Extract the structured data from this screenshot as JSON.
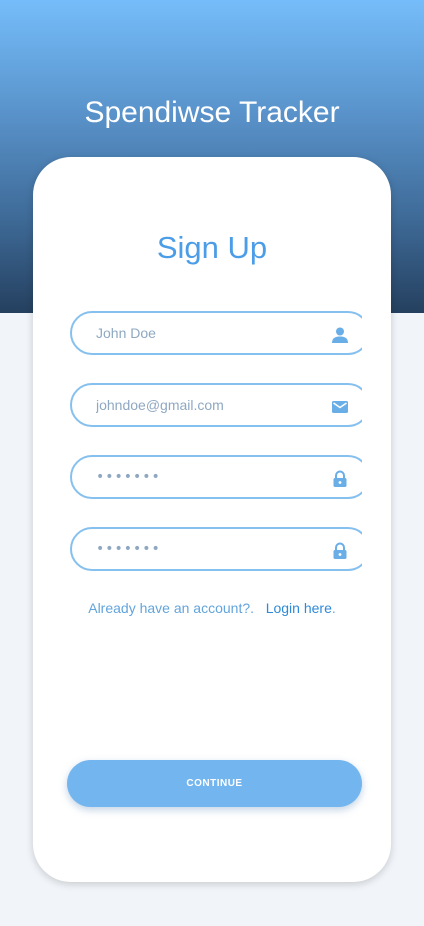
{
  "header": {
    "app_title": "Spendiwse Tracker"
  },
  "form": {
    "title": "Sign Up",
    "name_placeholder": "John Doe",
    "email_placeholder": "johndoe@gmail.com",
    "password_mask": "•••••••",
    "confirm_password_mask": "•••••••",
    "name_icon": "user-icon",
    "email_icon": "envelope-icon",
    "password_icon": "lock-icon",
    "confirm_password_icon": "lock-icon"
  },
  "login": {
    "prompt": "Already have an account?.",
    "link_label": "Login here",
    "suffix": "."
  },
  "actions": {
    "continue_label": "CONTINUE"
  },
  "colors": {
    "accent": "#4a9de6",
    "field_border": "#86c0ee",
    "button_bg": "#73b5ee",
    "header_top": "#75bdfa",
    "header_bottom": "#25405f",
    "page_bg": "#f1f5f9"
  }
}
